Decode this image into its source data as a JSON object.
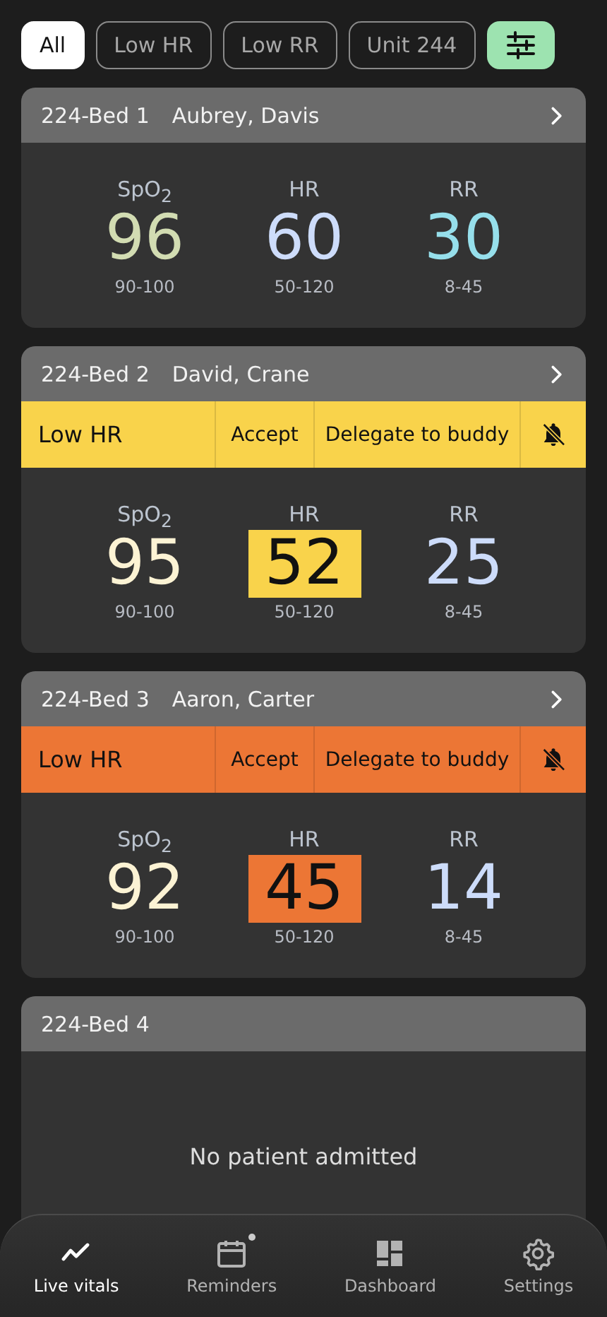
{
  "filters": [
    {
      "label": "All",
      "selected": true
    },
    {
      "label": "Low HR",
      "selected": false
    },
    {
      "label": "Low RR",
      "selected": false
    },
    {
      "label": "Unit 244",
      "selected": false
    }
  ],
  "beds": [
    {
      "bed": "224-Bed 1",
      "patient": "Aubrey, Davis",
      "vitals": [
        {
          "label": "SpO$_{2}$",
          "value": "96",
          "range": "90-100",
          "color": "#d2dcb2",
          "highlight": false
        },
        {
          "label": "HR",
          "value": "60",
          "range": "50-120",
          "color": "#cddcfa",
          "highlight": false
        },
        {
          "label": "RR",
          "value": "30",
          "range": "8-45",
          "color": "#96dfeb",
          "highlight": false
        }
      ]
    },
    {
      "bed": "224-Bed 2",
      "patient": "David, Crane",
      "alert": {
        "label": "Low HR",
        "color": "#f9d34b",
        "actions": [
          "Accept",
          "Delegate to buddy"
        ]
      },
      "vitals": [
        {
          "label": "SpO$_{2}$",
          "value": "95",
          "range": "90-100",
          "color": "#fcf3d4",
          "highlight": false
        },
        {
          "label": "HR",
          "value": "52",
          "range": "50-120",
          "color": "#f9d34b",
          "highlight": true
        },
        {
          "label": "RR",
          "value": "25",
          "range": "8-45",
          "color": "#cddcfa",
          "highlight": false
        }
      ]
    },
    {
      "bed": "224-Bed 3",
      "patient": "Aaron, Carter",
      "alert": {
        "label": "Low HR",
        "color": "#ec7635",
        "actions": [
          "Accept",
          "Delegate to buddy"
        ]
      },
      "vitals": [
        {
          "label": "SpO$_{2}$",
          "value": "92",
          "range": "90-100",
          "color": "#fcf3d4",
          "highlight": false
        },
        {
          "label": "HR",
          "value": "45",
          "range": "50-120",
          "color": "#ec7635",
          "highlight": true
        },
        {
          "label": "RR",
          "value": "14",
          "range": "8-45",
          "color": "#cddcfa",
          "highlight": false
        }
      ]
    },
    {
      "bed": "224-Bed 4",
      "empty_message": "No patient admitted"
    }
  ],
  "nav": [
    {
      "label": "Live vitals",
      "selected": true,
      "badge": false
    },
    {
      "label": "Reminders",
      "selected": false,
      "badge": true
    },
    {
      "label": "Dashboard",
      "selected": false,
      "badge": false
    },
    {
      "label": "Settings",
      "selected": false,
      "badge": false
    }
  ]
}
